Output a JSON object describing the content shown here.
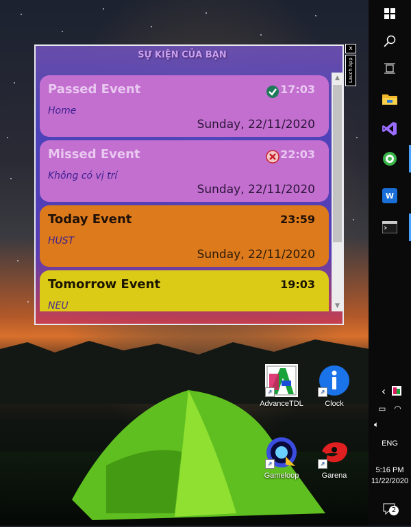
{
  "app": {
    "title": "SỰ KIỆN CỦA BẠN",
    "close_label": "x",
    "launch_label": "Lauch App"
  },
  "events": [
    {
      "name": "Passed Event",
      "time": "17:03",
      "location": "Home",
      "date": "Sunday, 22/11/2020",
      "status": "check-icon"
    },
    {
      "name": "Missed Event",
      "time": "22:03",
      "location": "Không có vị trí",
      "date": "Sunday, 22/11/2020",
      "status": "x-circle-icon"
    },
    {
      "name": "Today Event",
      "time": "23:59",
      "location": "HUST",
      "date": "Sunday, 22/11/2020"
    },
    {
      "name": "Tomorrow Event",
      "time": "19:03",
      "location": "NEU"
    }
  ],
  "desktop": {
    "icons": [
      {
        "label": "AdvanceTDL"
      },
      {
        "label": "Clock"
      },
      {
        "label": "Gameloop"
      },
      {
        "label": "Garena"
      }
    ]
  },
  "taskbar": {
    "language": "ENG",
    "time": "5:16 PM",
    "date": "11/22/2020",
    "notification_count": "2"
  }
}
